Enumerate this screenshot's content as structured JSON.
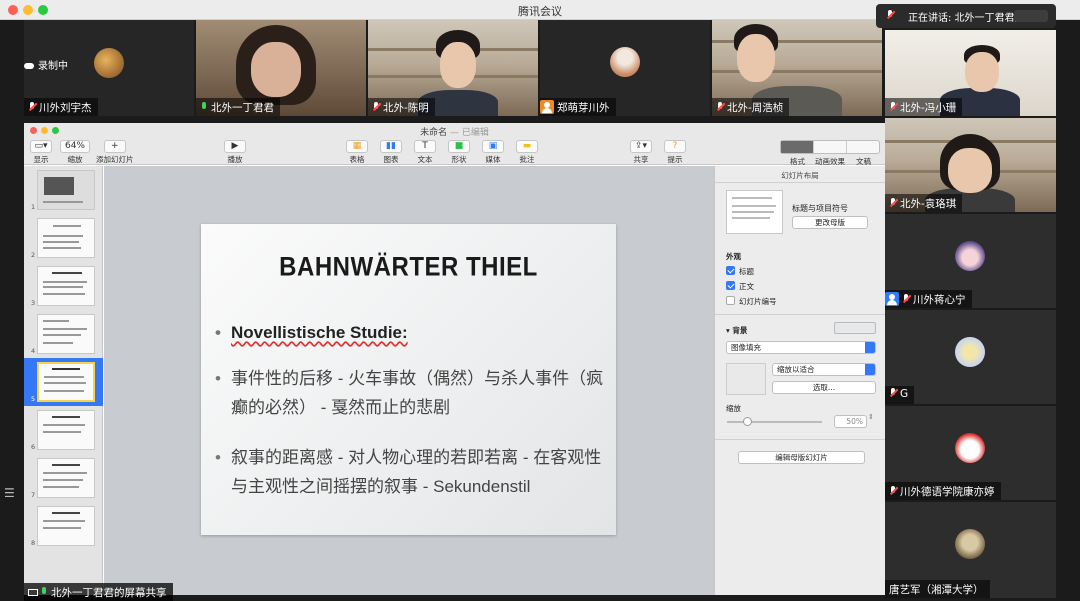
{
  "app": {
    "title": "腾讯会议",
    "recording": "录制中",
    "speaking": "正在讲话: 北外一丁君君;"
  },
  "participants_top": [
    {
      "name": "川外刘宇杰",
      "mic": "muted"
    },
    {
      "name": "北外一丁君君",
      "mic": "on"
    },
    {
      "name": "北外-陈明",
      "mic": "muted"
    },
    {
      "name": "郑萌芽川外",
      "mic": "none"
    },
    {
      "name": "北外-周浩桢",
      "mic": "muted"
    },
    {
      "name": "北外-冯小珊",
      "mic": "muted"
    }
  ],
  "participants_side": [
    {
      "name": "北外-袁珞琪",
      "mic": "muted"
    },
    {
      "name": "川外蒋心宁",
      "mic": "muted"
    },
    {
      "name": "G",
      "mic": "muted"
    },
    {
      "name": "川外德语学院康亦婷",
      "mic": "muted"
    },
    {
      "name": "唐艺军（湘潭大学）",
      "mic": "none"
    }
  ],
  "share_label": "北外一丁君君的屏幕共享",
  "keynote": {
    "doc_title": "未命名",
    "doc_status": "— 已编辑",
    "toolbar": {
      "view": "显示",
      "zoom_value": "64%",
      "zoom": "缩放",
      "add_slide": "添加幻灯片",
      "play": "播放",
      "table": "表格",
      "chart": "图表",
      "text": "文本",
      "shape": "形状",
      "media": "媒体",
      "comment": "批注",
      "share": "共享",
      "tips": "提示",
      "format": "格式",
      "animate": "动画效果",
      "document": "文稿"
    },
    "slide_numbers": [
      "1",
      "2",
      "3",
      "4",
      "5",
      "6",
      "7",
      "8"
    ],
    "slide": {
      "title": "BAHNWÄRTER THIEL",
      "bullet1": "Novellistische Studie:",
      "bullet2": "事件性的后移 - 火车事故（偶然）与杀人事件（疯癫的必然） - 戛然而止的悲剧",
      "bullet3": "叙事的距离感 - 对人物心理的若即若离 - 在客观性与主观性之间摇摆的叙事 - Sekundenstil"
    },
    "inspector": {
      "header": "幻灯片布局",
      "layout_name": "标题与项目符号",
      "change_master": "更改母版",
      "appearance": "外观",
      "title_chk": "标题",
      "body_chk": "正文",
      "number_chk": "幻灯片编号",
      "background": "背景",
      "fill_type": "图像填充",
      "scale_mode": "缩放以适合",
      "choose": "选取...",
      "scale": "缩放",
      "scale_value": "50%",
      "edit_master": "编辑母版幻灯片"
    }
  },
  "colors": {
    "accent": "#3478f6",
    "mic_on": "#3fd35b",
    "muted": "#ff4a4a",
    "selection_border": "#f5d44a"
  }
}
